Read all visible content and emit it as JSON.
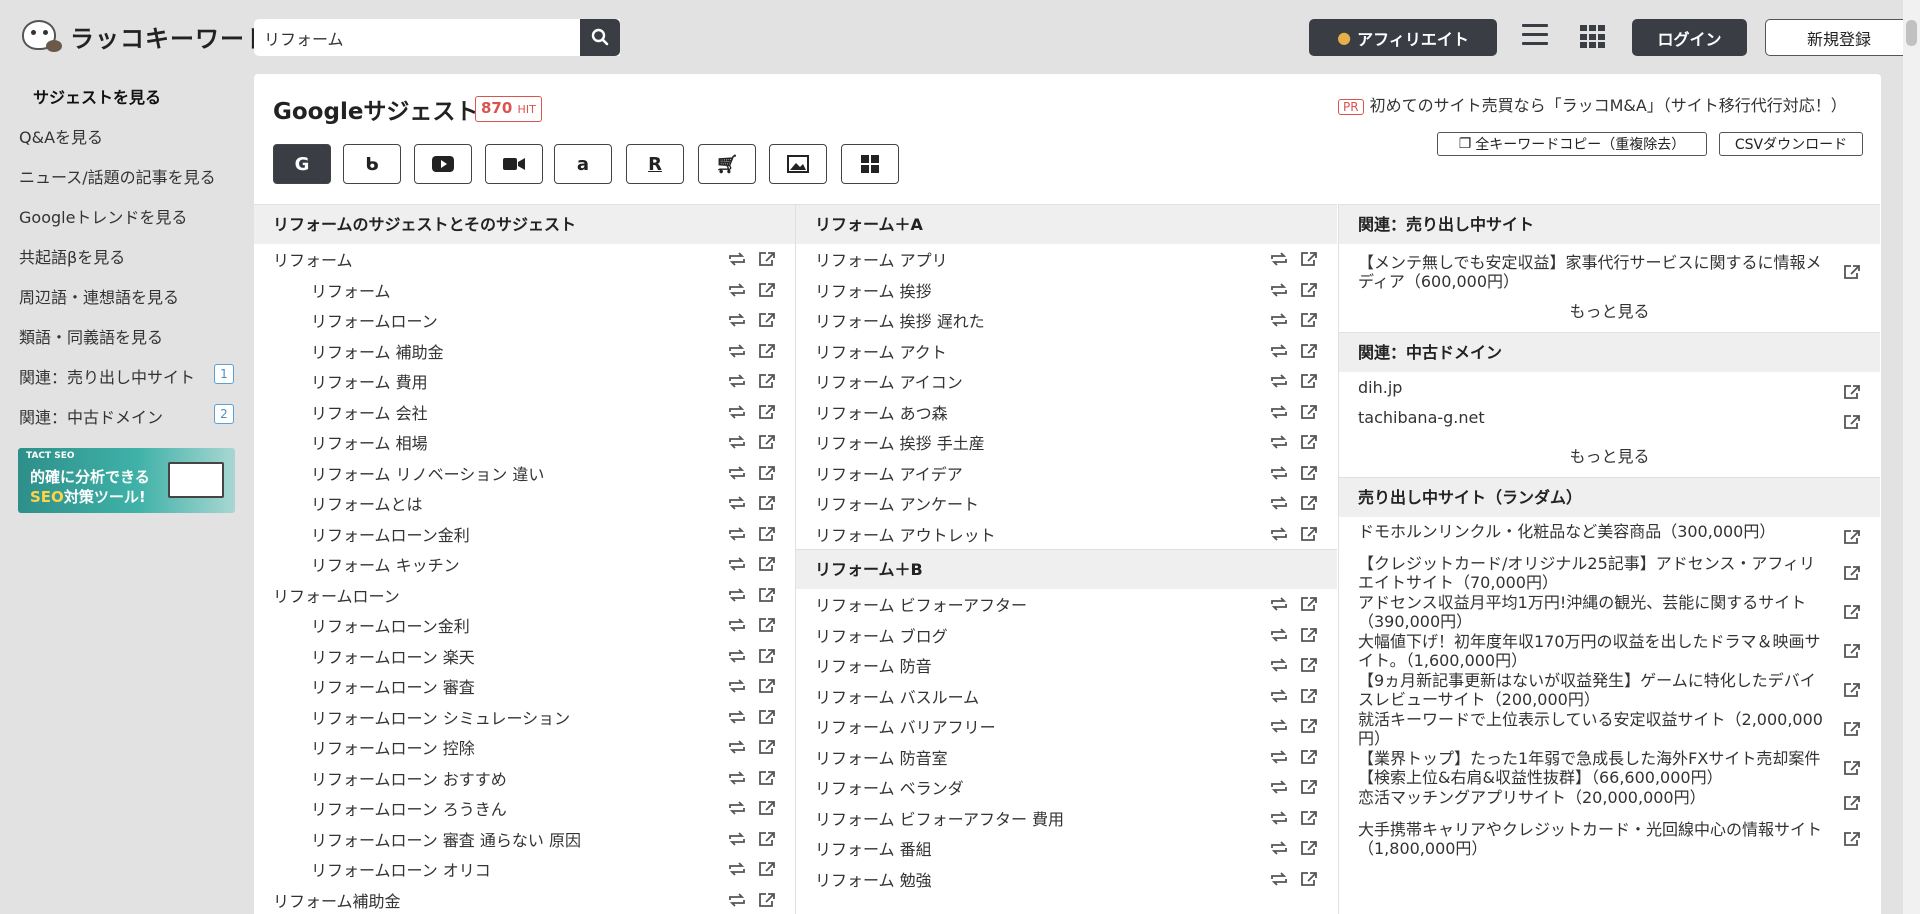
{
  "header": {
    "logo_text": "ラッコキーワード",
    "search_value": "リフォーム",
    "affiliate_label": "アフィリエイト",
    "login_label": "ログイン",
    "signup_label": "新規登録"
  },
  "sidebar": {
    "items": [
      {
        "label": "サジェストを見る",
        "active": true
      },
      {
        "label": "Q&Aを見る"
      },
      {
        "label": "ニュース/話題の記事を見る"
      },
      {
        "label": "Googleトレンドを見る"
      },
      {
        "label": "共起語βを見る"
      },
      {
        "label": "周辺語・連想語を見る"
      },
      {
        "label": "類語・同義語を見る"
      },
      {
        "label": "関連：売り出し中サイト",
        "badge": "1"
      },
      {
        "label": "関連：中古ドメイン",
        "badge": "2"
      }
    ],
    "banner": {
      "brand": "TACT SEO",
      "line1": "的確に分析できる",
      "line2_accent": "SEO",
      "line2": "対策ツール!"
    }
  },
  "main": {
    "title": "Googleサジェスト",
    "hit_count": "870",
    "hit_unit": "HIT",
    "pr_tag": "PR",
    "pr_text": "初めてのサイト売買なら「ラッコM&A」（サイト移行代行対応！）",
    "copy_all_label": "全キーワードコピー（重複除去）",
    "csv_label": "CSVダウンロード",
    "engines": [
      "G",
      "b",
      "yt",
      "video",
      "a",
      "R",
      "cart",
      "image",
      "win"
    ]
  },
  "column1": {
    "heading": "リフォームのサジェストとそのサジェスト",
    "rows": [
      {
        "text": "リフォーム",
        "sub": false
      },
      {
        "text": "リフォーム",
        "sub": true
      },
      {
        "text": "リフォームローン",
        "sub": true
      },
      {
        "text": "リフォーム 補助金",
        "sub": true
      },
      {
        "text": "リフォーム 費用",
        "sub": true
      },
      {
        "text": "リフォーム 会社",
        "sub": true
      },
      {
        "text": "リフォーム 相場",
        "sub": true
      },
      {
        "text": "リフォーム リノベーション 違い",
        "sub": true
      },
      {
        "text": "リフォームとは",
        "sub": true
      },
      {
        "text": "リフォームローン金利",
        "sub": true
      },
      {
        "text": "リフォーム キッチン",
        "sub": true
      },
      {
        "text": "リフォームローン",
        "sub": false
      },
      {
        "text": "リフォームローン金利",
        "sub": true
      },
      {
        "text": "リフォームローン 楽天",
        "sub": true
      },
      {
        "text": "リフォームローン 審査",
        "sub": true
      },
      {
        "text": "リフォームローン シミュレーション",
        "sub": true
      },
      {
        "text": "リフォームローン 控除",
        "sub": true
      },
      {
        "text": "リフォームローン おすすめ",
        "sub": true
      },
      {
        "text": "リフォームローン ろうきん",
        "sub": true
      },
      {
        "text": "リフォームローン 審査 通らない 原因",
        "sub": true
      },
      {
        "text": "リフォームローン オリコ",
        "sub": true
      },
      {
        "text": "リフォーム補助金",
        "sub": false
      }
    ]
  },
  "column2": {
    "group_a": {
      "heading": "リフォーム＋A",
      "rows": [
        "リフォーム アプリ",
        "リフォーム 挨拶",
        "リフォーム 挨拶 遅れた",
        "リフォーム アクト",
        "リフォーム アイコン",
        "リフォーム あつ森",
        "リフォーム 挨拶 手土産",
        "リフォーム アイデア",
        "リフォーム アンケート",
        "リフォーム アウトレット"
      ]
    },
    "group_b": {
      "heading": "リフォーム＋B",
      "rows": [
        "リフォーム ビフォーアフター",
        "リフォーム ブログ",
        "リフォーム 防音",
        "リフォーム バスルーム",
        "リフォーム バリアフリー",
        "リフォーム 防音室",
        "リフォーム ベランダ",
        "リフォーム ビフォーアフター 費用",
        "リフォーム 番組",
        "リフォーム 勉強"
      ]
    }
  },
  "column3": {
    "sites_for_sale": {
      "heading": "関連：売り出し中サイト",
      "items": [
        "【メンテ無しでも安定収益】家事代行サービスに関するに情報メディア（600,000円）"
      ],
      "more": "もっと見る"
    },
    "domains": {
      "heading": "関連：中古ドメイン",
      "items": [
        "dih.jp",
        "tachibana-g.net"
      ],
      "more": "もっと見る"
    },
    "random_sites": {
      "heading": "売り出し中サイト（ランダム）",
      "items": [
        "ドモホルンリンクル・化粧品など美容商品（300,000円）",
        "【クレジットカード/オリジナル25記事】アドセンス・アフィリエイトサイト（70,000円）",
        "アドセンス収益月平均1万円!沖縄の観光、芸能に関するサイト（390,000円）",
        "大幅値下げ！初年度年収170万円の収益を出したドラマ＆映画サイト。（1,600,000円）",
        "【9ヵ月新記事更新はないが収益発生】ゲームに特化したデバイスレビューサイト（200,000円）",
        "就活キーワードで上位表示している安定収益サイト（2,000,000円）",
        "【業界トップ】たった1年弱で急成長した海外FXサイト売却案件【検索上位&右肩&収益性抜群】（66,600,000円）",
        "恋活マッチングアプリサイト（20,000,000円）",
        "大手携帯キャリアやクレジットカード・光回線中心の情報サイト（1,800,000円）"
      ]
    }
  }
}
